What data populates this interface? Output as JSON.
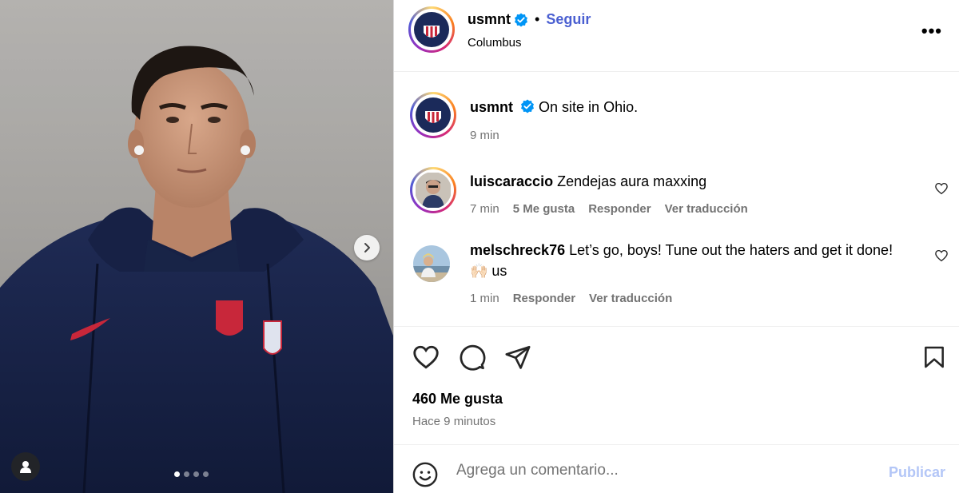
{
  "post": {
    "author": "usmnt",
    "follow_label": "Seguir",
    "separator": "•",
    "location": "Columbus",
    "more_label": "•••",
    "carousel": {
      "slides": 4,
      "active_index": 0
    }
  },
  "caption": {
    "username": "usmnt",
    "text": "On site in Ohio.",
    "time": "9 min"
  },
  "comments": [
    {
      "username": "luiscaraccio",
      "text": "Zendejas aura maxxing",
      "time": "7 min",
      "likes": "5 Me gusta",
      "reply": "Responder",
      "translate": "Ver traducción"
    },
    {
      "username": "melschreck76",
      "text": "Let’s go, boys! Tune out the haters and get it done! 🙌🏻 us",
      "time": "1 min",
      "reply": "Responder",
      "translate": "Ver traducción"
    }
  ],
  "stats": {
    "likes": "460 Me gusta",
    "posted": "Hace 9 minutos"
  },
  "composer": {
    "placeholder": "Agrega un comentario...",
    "publish_label": "Publicar"
  },
  "colors": {
    "follow_blue": "#4a5fd1",
    "verified_blue": "#0095f6",
    "meta_gray": "#737373",
    "publish_disabled": "#b3c6f7"
  },
  "icons": {
    "like": "heart-icon",
    "comment": "comment-icon",
    "share": "send-icon",
    "save": "bookmark-icon",
    "emoji": "emoji-icon",
    "next": "chevron-right-icon",
    "tags": "user-tag-icon"
  }
}
